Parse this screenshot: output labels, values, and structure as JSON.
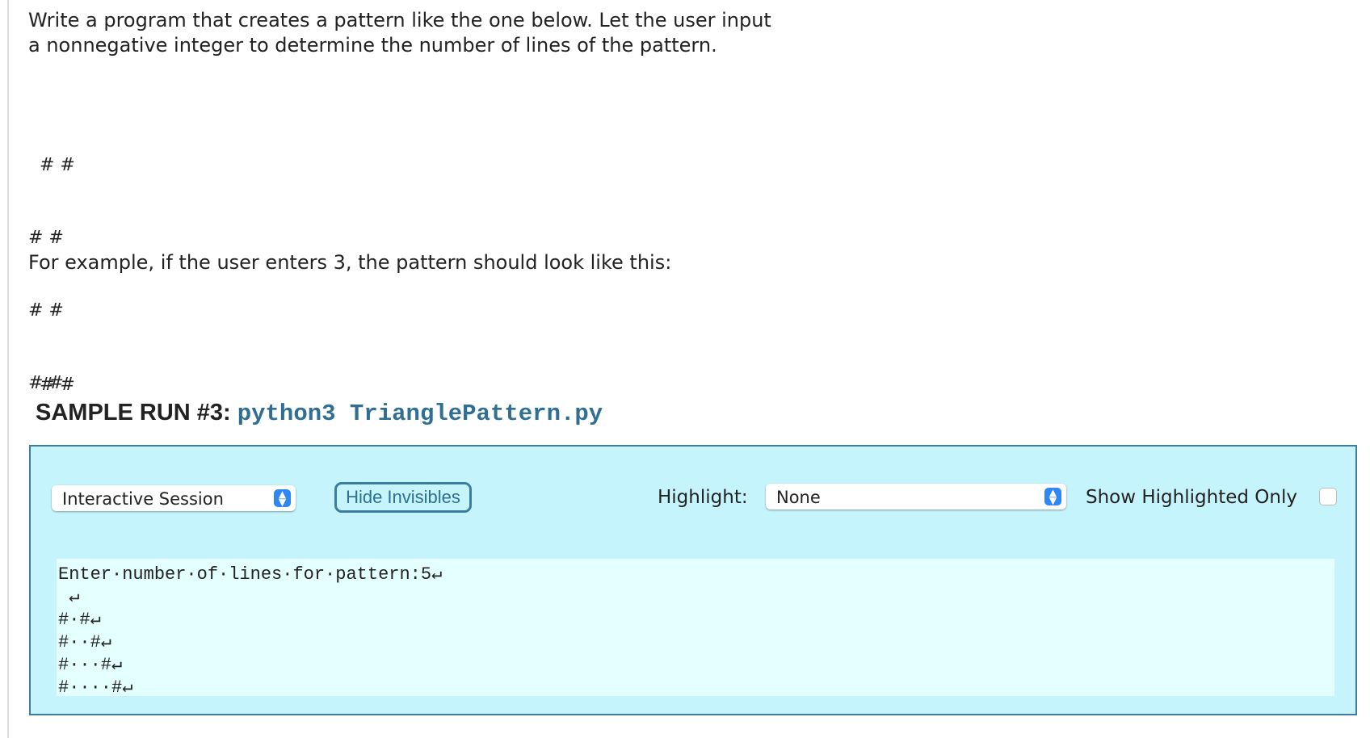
{
  "prompt": {
    "line1": "Write a program that creates a pattern like the one below. Let the user input",
    "line2": "a nonnegative integer to determine the number of lines of the pattern."
  },
  "pattern_example": [
    "  # #",
    "# #",
    "# #",
    "# #",
    "# #"
  ],
  "example_text": "For example, if the user enters 3, the pattern should look like this:",
  "pattern_example_3": [
    "  # #",
    "# #"
  ],
  "sample_run": {
    "label": "SAMPLE RUN #3:",
    "command": "python3 TrianglePattern.py"
  },
  "panel": {
    "mode_select": {
      "value": "Interactive Session",
      "icon": "updown-arrows-icon"
    },
    "hide_invisibles_label": "Hide Invisibles",
    "highlight_label": "Highlight:",
    "highlight_select": {
      "value": "None",
      "icon": "updown-arrows-icon"
    },
    "show_highlighted_label": "Show Highlighted Only",
    "show_highlighted_checked": false,
    "output_lines": [
      "Enter·number·of·lines·for·pattern:5↵",
      " ↵",
      "#·#↵",
      "#··#↵",
      "#···#↵",
      "#····#↵"
    ]
  },
  "colors": {
    "panel_bg": "#c5f4fc",
    "panel_border": "#3a7d9e",
    "output_bg": "#e3ffff",
    "command_color": "#2e6f93",
    "select_arrow_bg": "#2f86f5"
  }
}
